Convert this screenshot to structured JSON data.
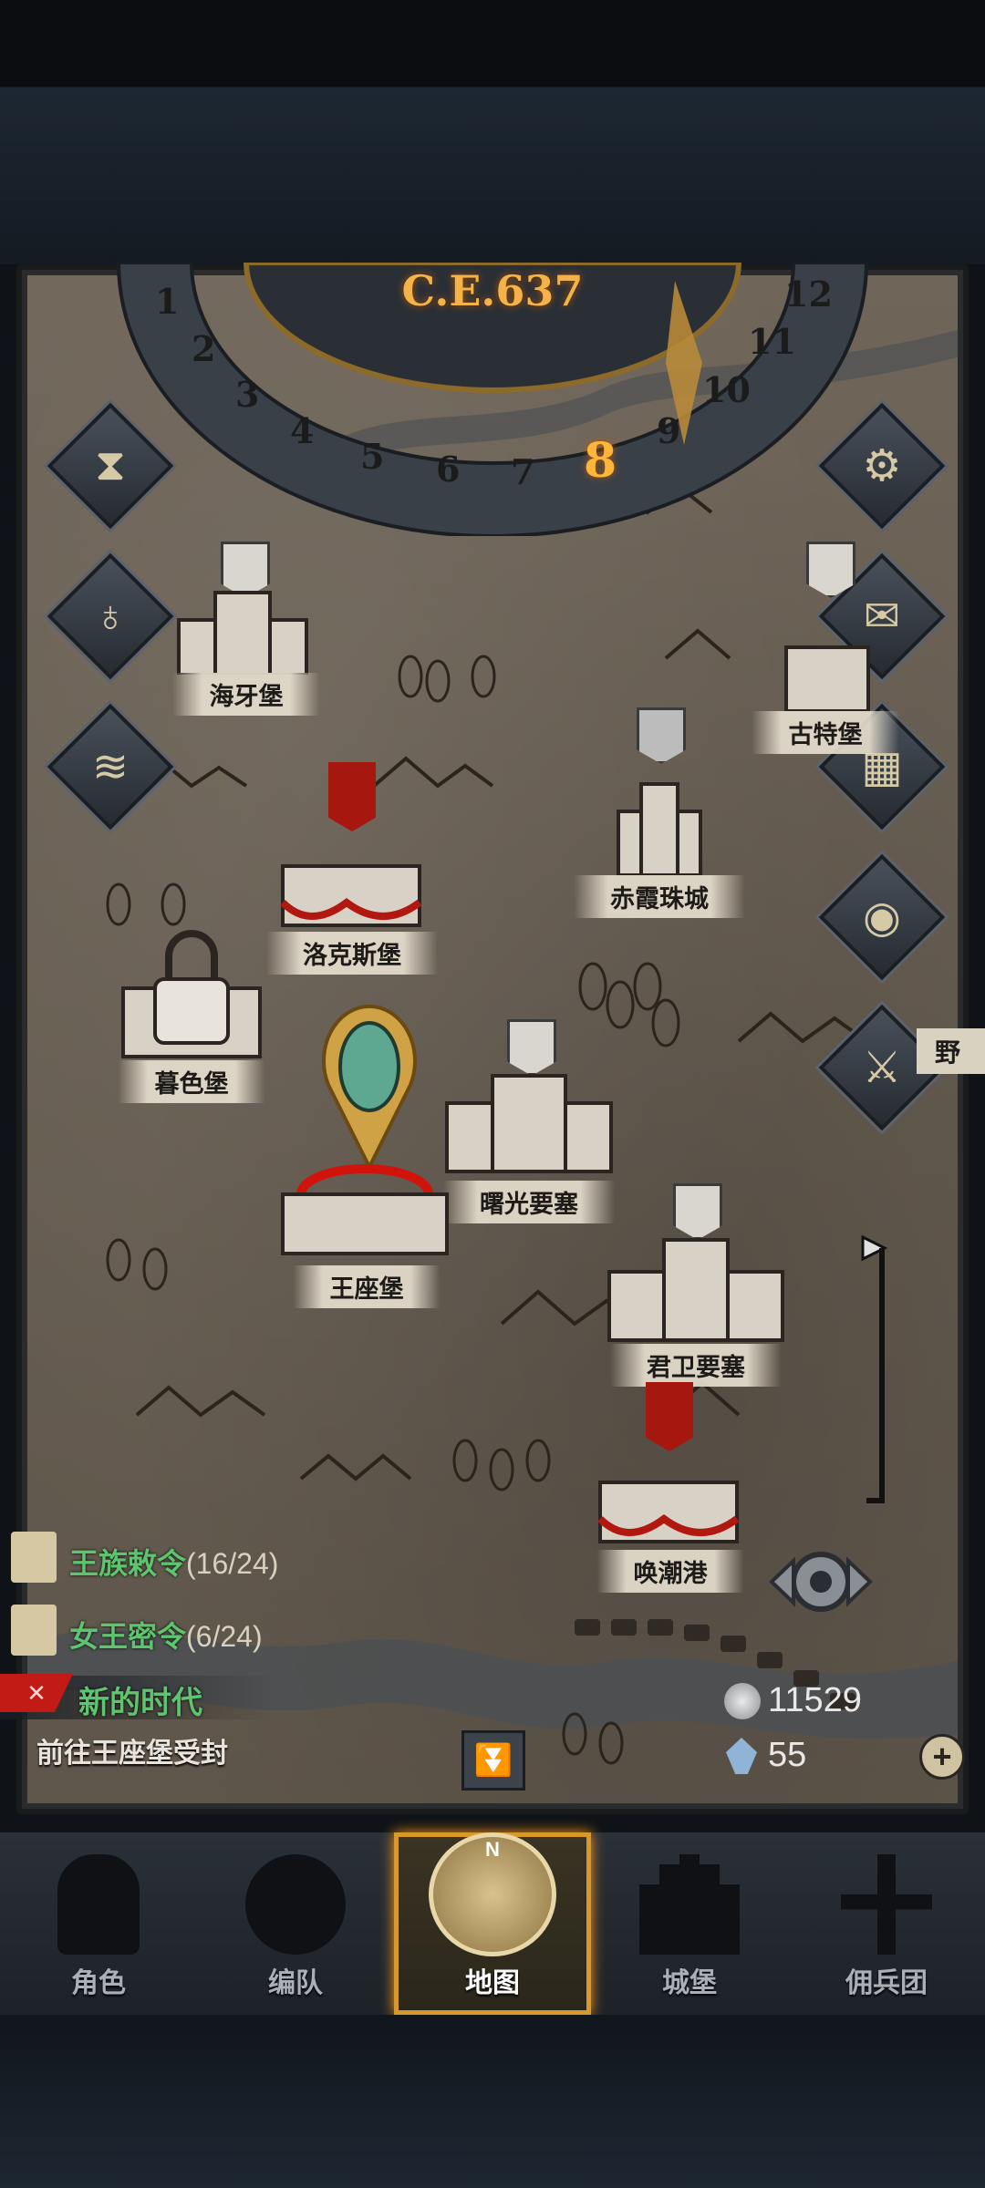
{
  "era": "C.E.637",
  "months": [
    "1",
    "2",
    "3",
    "4",
    "5",
    "6",
    "7",
    "8",
    "9",
    "10",
    "11",
    "12"
  ],
  "active_month": "8",
  "castles": {
    "haiya": "海牙堡",
    "gute": "古特堡",
    "chixia": "赤霞珠城",
    "luokesi": "洛克斯堡",
    "mose": "暮色堡",
    "shuguang": "曙光要塞",
    "wangzuo": "王座堡",
    "junwei": "君卫要塞",
    "huanchao": "唤潮港"
  },
  "right_label": "野",
  "quests": {
    "royal_edict": {
      "name": "王族敕令",
      "count": "(16/24)"
    },
    "queen_secret": {
      "name": "女王密令",
      "count": "(6/24)"
    },
    "main_title": "新的时代",
    "main_desc": "前往王座堡受封"
  },
  "resources": {
    "silver": "11529",
    "crystal": "55"
  },
  "tabs": [
    {
      "label": "角色"
    },
    {
      "label": "编队"
    },
    {
      "label": "地图"
    },
    {
      "label": "城堡"
    },
    {
      "label": "佣兵团"
    }
  ],
  "compass_letter": "N",
  "colors": {
    "accent": "#f3b34a",
    "quest_green": "#5fc46f",
    "banner_red": "#a6170f"
  }
}
